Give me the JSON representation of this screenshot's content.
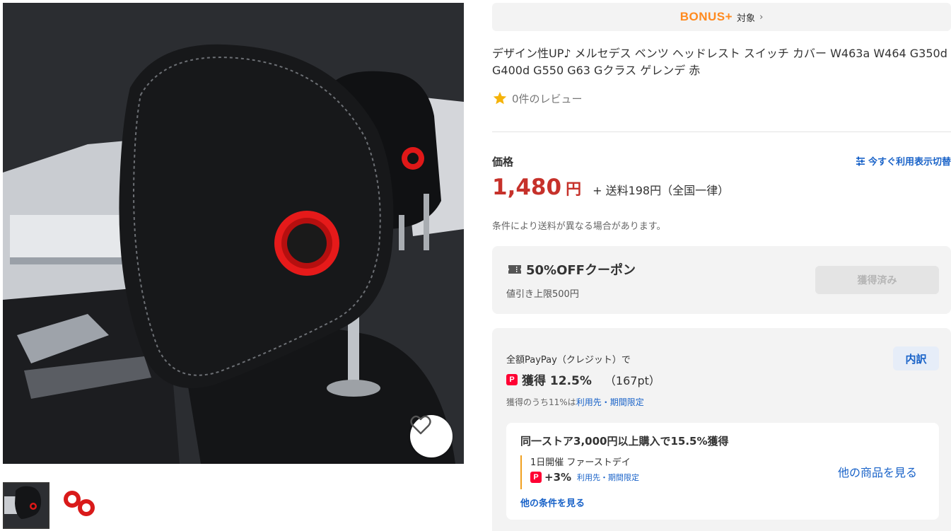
{
  "product_image": {
    "alt": "Mercedes headrest switch cover red"
  },
  "thumbnails": [
    {
      "name": "thumb-headrest"
    },
    {
      "name": "thumb-rings"
    }
  ],
  "bonus": {
    "logo": "BONUS+",
    "label": "対象",
    "chevron": "›"
  },
  "title": "デザイン性UP♪ メルセデス ベンツ ヘッドレスト スイッチ カバー W463a W464 G350d G400d G550 G63 Gクラス ゲレンデ 赤",
  "review": {
    "text": "0件のレビュー"
  },
  "price": {
    "label": "価格",
    "switch_link": "今すぐ利用表示切替",
    "amount": "1,480",
    "yen": "円",
    "shipping": "+ 送料198円（全国一律）",
    "note": "条件により送料が異なる場合があります。"
  },
  "coupon": {
    "title": "50%OFFクーポン",
    "sub": "値引き上限500円",
    "button": "獲得済み"
  },
  "paypay": {
    "lead": "全額PayPay（クレジット）で",
    "get": "獲得 12.5%",
    "points": "（167pt）",
    "sub_prefix": "獲得のうち11%は",
    "sub_link": "利用先・期間限定",
    "breakdown": "内訳",
    "icon_letter": "P"
  },
  "store_campaign": {
    "title": "同一ストア3,000円以上購入で15.5%獲得",
    "event": "1日開催 ファーストデイ",
    "plus": "+3%",
    "plus_note": "利用先・期間限定",
    "other": "他の条件を見る",
    "more": "他の商品を見る"
  },
  "colors": {
    "accent_price": "#c6312a",
    "link": "#1862c8",
    "bonus": "#ff8a1f",
    "paypay": "#ff0033"
  }
}
